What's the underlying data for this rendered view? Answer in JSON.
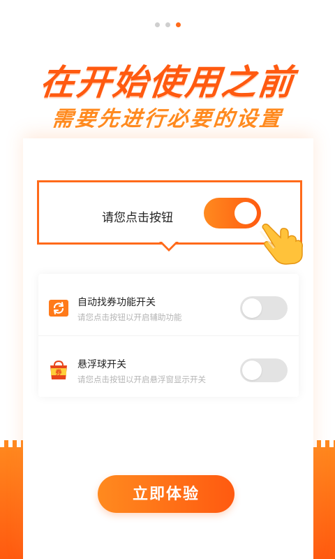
{
  "pager": {
    "count": 3,
    "active": 3
  },
  "headline": {
    "title": "在开始使用之前",
    "subtitle": "需要先进行必要的设置"
  },
  "callout": {
    "label": "请您点击按钮",
    "toggle_on": true
  },
  "settings": {
    "items": [
      {
        "title": "自动找券功能开关",
        "subtitle": "请您点击按钮以开启辅助功能",
        "icon": "refresh-coupon-icon",
        "enabled": false
      },
      {
        "title": "悬浮球开关",
        "subtitle": "请您点击按钮以开启悬浮窗显示开关",
        "icon": "coupon-bag-icon",
        "enabled": false
      }
    ]
  },
  "cta": {
    "label": "立即体验"
  },
  "colors": {
    "accent": "#ff6a1a",
    "accent_light": "#ff8a1f",
    "toggle_off": "#e3e3e3"
  }
}
